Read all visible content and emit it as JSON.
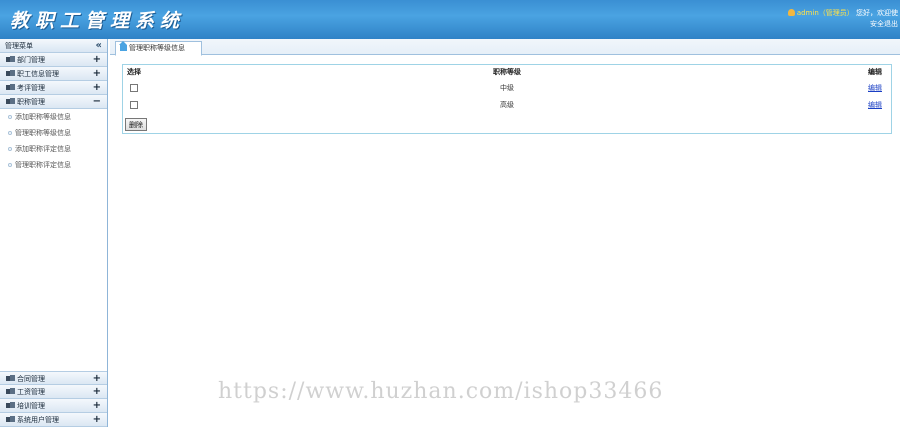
{
  "header": {
    "title": "教职工管理系统",
    "user_name": "admin（管理员）",
    "greeting": "您好，欢迎使",
    "logout": "安全退出"
  },
  "sidebar": {
    "menu_title": "管理菜单",
    "collapse_icon": "«",
    "groups_top": [
      {
        "label": "部门管理",
        "toggle": "+"
      },
      {
        "label": "职工信息管理",
        "toggle": "+"
      },
      {
        "label": "考评管理",
        "toggle": "+"
      },
      {
        "label": "职称管理",
        "toggle": "−"
      }
    ],
    "sub_items": [
      {
        "label": "添加职称等级信息"
      },
      {
        "label": "管理职称等级信息"
      },
      {
        "label": "添加职称评定信息"
      },
      {
        "label": "管理职称评定信息"
      }
    ],
    "groups_bottom": [
      {
        "label": "合同管理",
        "toggle": "+"
      },
      {
        "label": "工资管理",
        "toggle": "+"
      },
      {
        "label": "培训管理",
        "toggle": "+"
      },
      {
        "label": "系统用户管理",
        "toggle": "+"
      }
    ]
  },
  "tab": {
    "label": "管理职称等级信息"
  },
  "table": {
    "columns": [
      "选择",
      "职称等级",
      "编辑"
    ],
    "rows": [
      {
        "level": "中级",
        "edit": "编辑"
      },
      {
        "level": "高级",
        "edit": "编辑"
      }
    ],
    "delete_button": "删除"
  },
  "watermark": "https://www.huzhan.com/ishop33466",
  "colors": {
    "header_blue": "#3a8fd3",
    "link_blue": "#1a3fc4",
    "panel_border": "#9fd3e6"
  }
}
